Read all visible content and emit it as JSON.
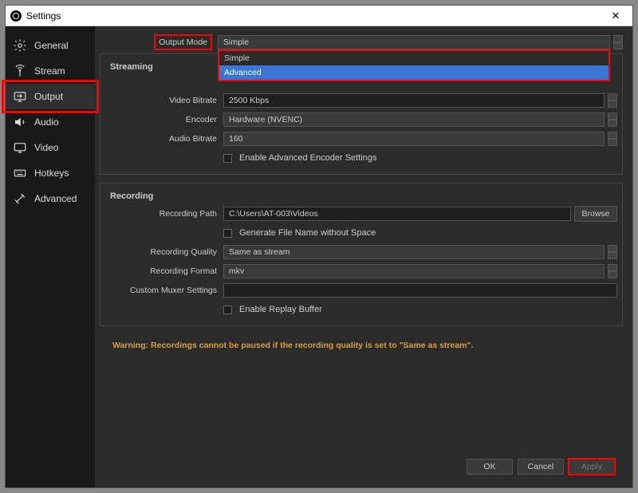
{
  "window": {
    "title": "Settings",
    "close": "✕"
  },
  "sidebar": {
    "items": [
      {
        "label": "General"
      },
      {
        "label": "Stream"
      },
      {
        "label": "Output"
      },
      {
        "label": "Audio"
      },
      {
        "label": "Video"
      },
      {
        "label": "Hotkeys"
      },
      {
        "label": "Advanced"
      }
    ]
  },
  "output_mode": {
    "label": "Output Mode",
    "value": "Simple",
    "opt_simple": "Simple",
    "opt_advanced": "Advanced"
  },
  "streaming": {
    "title": "Streaming",
    "video_bitrate": {
      "label": "Video Bitrate",
      "value": "2500 Kbps"
    },
    "encoder": {
      "label": "Encoder",
      "value": "Hardware (NVENC)"
    },
    "audio_bitrate": {
      "label": "Audio Bitrate",
      "value": "160"
    },
    "adv_encoder": {
      "label": "Enable Advanced Encoder Settings"
    }
  },
  "recording": {
    "title": "Recording",
    "path": {
      "label": "Recording Path",
      "value": "C:\\Users\\AT-003\\Videos",
      "browse": "Browse"
    },
    "no_space": {
      "label": "Generate File Name without Space"
    },
    "quality": {
      "label": "Recording Quality",
      "value": "Same as stream"
    },
    "format": {
      "label": "Recording Format",
      "value": "mkv"
    },
    "muxer": {
      "label": "Custom Muxer Settings",
      "value": ""
    },
    "replay": {
      "label": "Enable Replay Buffer"
    }
  },
  "warning": "Warning: Recordings cannot be paused if the recording quality is set to \"Same as stream\".",
  "footer": {
    "ok": "OK",
    "cancel": "Cancel",
    "apply": "Apply"
  }
}
